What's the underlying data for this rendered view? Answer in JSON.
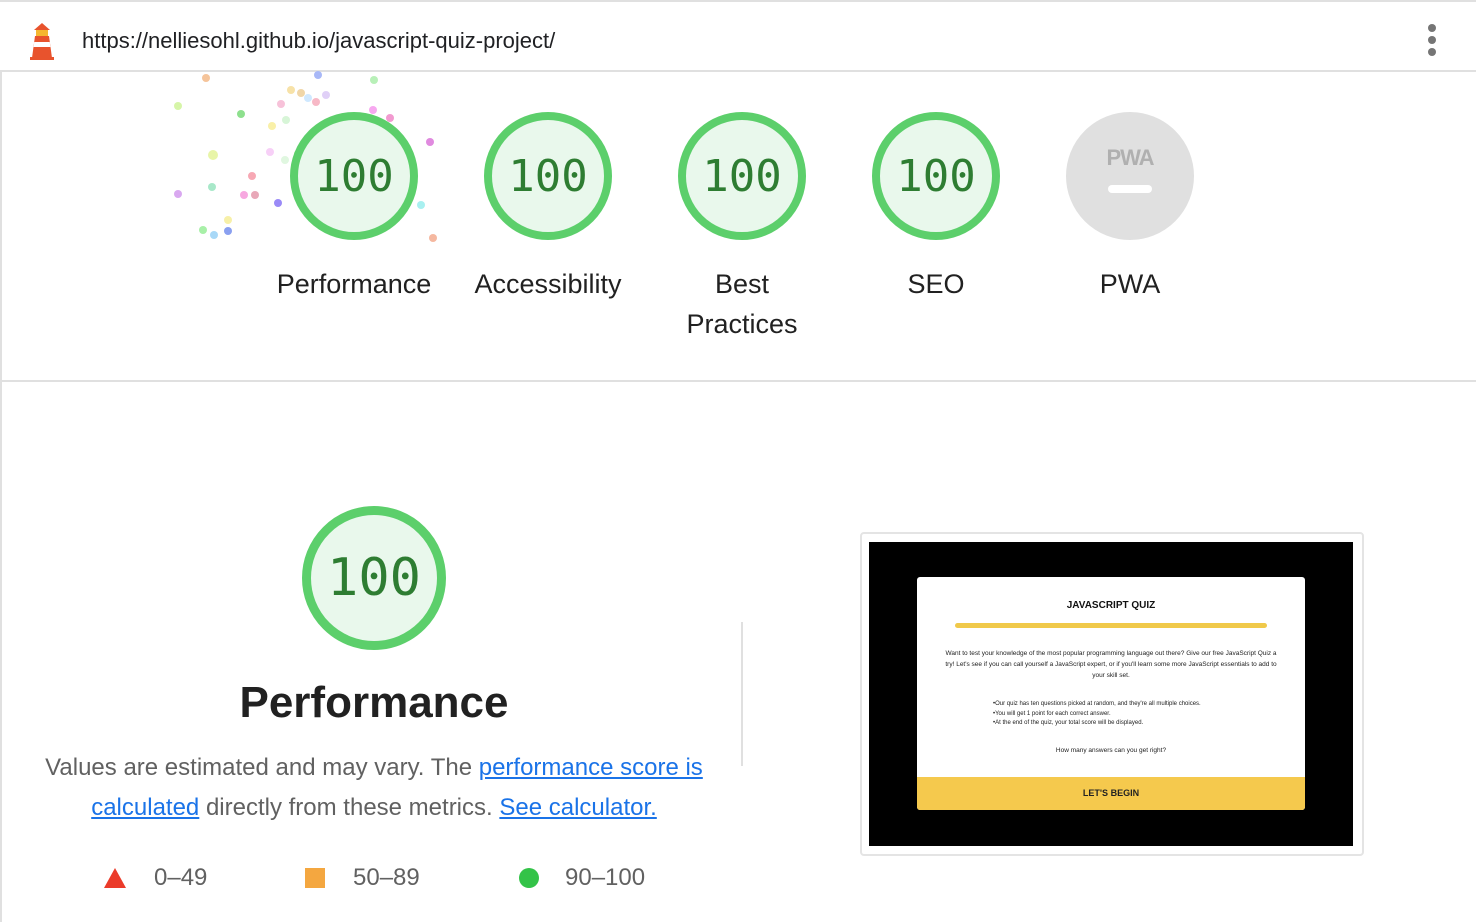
{
  "topbar": {
    "url": "https://nelliesohl.github.io/javascript-quiz-project/",
    "logo_icon": "lighthouse-icon",
    "menu_icon": "more-vert-icon"
  },
  "gauges": [
    {
      "key": "performance",
      "score": "100",
      "label": "Performance"
    },
    {
      "key": "accessibility",
      "score": "100",
      "label": "Accessibility"
    },
    {
      "key": "best-practices",
      "score": "100",
      "label_line1": "Best",
      "label_line2": "Practices"
    },
    {
      "key": "seo",
      "score": "100",
      "label": "SEO"
    },
    {
      "key": "pwa",
      "badge_text": "PWA",
      "label": "PWA"
    }
  ],
  "performance_section": {
    "score": "100",
    "title": "Performance",
    "desc_prefix": "Values are estimated and may vary. The ",
    "link_score": "performance score is calculated",
    "desc_mid": " directly from these metrics. ",
    "link_calculator": "See calculator."
  },
  "legend": [
    {
      "shape": "triangle",
      "range": "0–49",
      "color": "#eb3b2a"
    },
    {
      "shape": "square",
      "range": "50–89",
      "color": "#f4a740"
    },
    {
      "shape": "circle",
      "range": "90–100",
      "color": "#33c348"
    }
  ],
  "screenshot": {
    "title": "JAVASCRIPT QUIZ",
    "intro": "Want to test your knowledge of the most popular programming language out there? Give our free JavaScript Quiz a try! Let's see if you can call yourself a JavaScript expert, or if you'll learn some more JavaScript essentials to add to your skill set.",
    "bullets": [
      "Our quiz has ten questions picked at random, and they're all multiple choices.",
      "You will get 1 point for each correct answer.",
      "At the end of the quiz, your total score will be displayed."
    ],
    "question": "How many answers can you get right?",
    "button": "LET'S BEGIN"
  },
  "colors": {
    "pass": "#5ccf6b",
    "pass_fill": "#e9f8ec",
    "pass_text": "#2e7d32",
    "link": "#1a73e8",
    "quiz_accent": "#f5c94d"
  }
}
